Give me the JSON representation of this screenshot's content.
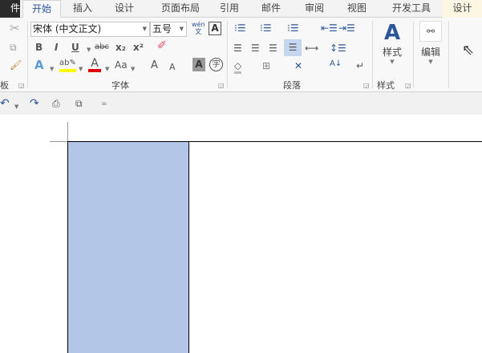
{
  "tabs": {
    "file": "件",
    "items": [
      "开始",
      "插入",
      "设计",
      "页面布局",
      "引用",
      "邮件",
      "审阅",
      "视图",
      "开发工具"
    ],
    "context": "设计"
  },
  "clipboard": {
    "label": "板"
  },
  "font": {
    "name": "宋体 (中文正文)",
    "size": "五号",
    "bold": "B",
    "italic": "I",
    "underline": "U",
    "strike": "abc",
    "sub": "x₂",
    "sup": "x²",
    "case": "Aa",
    "grow": "A",
    "shrink": "A",
    "shade": "A",
    "enclose": "字",
    "phonetic": "wén",
    "phonetic2": "文",
    "border": "A",
    "label": "字体",
    "highlight_color": "#ffff00",
    "font_color": "#e00000"
  },
  "paragraph": {
    "label": "段落"
  },
  "styles": {
    "button": "样式",
    "label": "样式"
  },
  "editing": {
    "button": "编辑"
  },
  "qat": {
    "customize": "="
  },
  "colors": {
    "accent": "#2b579a",
    "cell_shading": "#b4c6e7"
  }
}
